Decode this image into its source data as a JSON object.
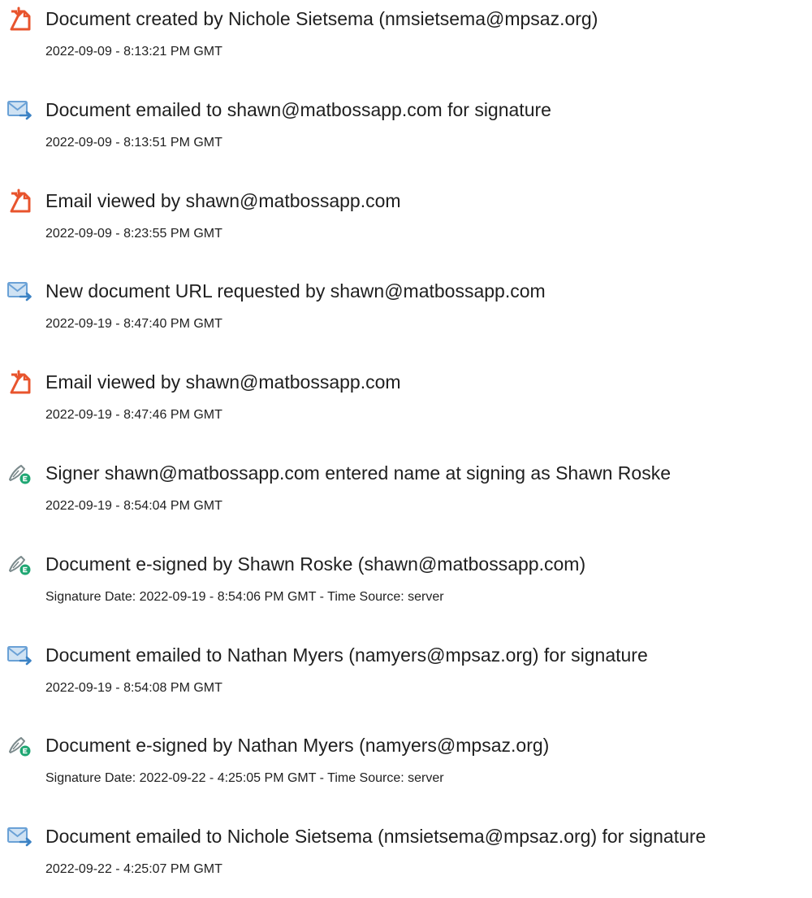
{
  "colors": {
    "text": "#1f1f1f",
    "doc_icon": "#e8542d",
    "mail_icon_body": "#cfe2f3",
    "mail_icon_stroke": "#6aa1d6",
    "mail_icon_arrow": "#3b82c4",
    "pen_icon": "#7b8a8c",
    "pen_badge": "#1ea672"
  },
  "entries": [
    {
      "icon": "document-icon",
      "title": "Document created by Nichole Sietsema (nmsietsema@mpsaz.org)",
      "detail": "2022-09-09 - 8:13:21 PM GMT"
    },
    {
      "icon": "email-sent-icon",
      "title": "Document emailed to shawn@matbossapp.com for signature",
      "detail": "2022-09-09 - 8:13:51 PM GMT"
    },
    {
      "icon": "document-icon",
      "title": "Email viewed by shawn@matbossapp.com",
      "detail": "2022-09-09 - 8:23:55 PM GMT"
    },
    {
      "icon": "email-sent-icon",
      "title": "New document URL requested by shawn@matbossapp.com",
      "detail": "2022-09-19 - 8:47:40 PM GMT"
    },
    {
      "icon": "document-icon",
      "title": "Email viewed by shawn@matbossapp.com",
      "detail": "2022-09-19 - 8:47:46 PM GMT"
    },
    {
      "icon": "esign-pen-icon",
      "title": "Signer shawn@matbossapp.com entered name at signing as Shawn Roske",
      "detail": "2022-09-19 - 8:54:04 PM GMT"
    },
    {
      "icon": "esign-pen-icon",
      "title": "Document e-signed by Shawn Roske (shawn@matbossapp.com)",
      "detail": "Signature Date: 2022-09-19 - 8:54:06 PM GMT - Time Source: server"
    },
    {
      "icon": "email-sent-icon",
      "title": "Document emailed to Nathan Myers (namyers@mpsaz.org) for signature",
      "detail": "2022-09-19 - 8:54:08 PM GMT"
    },
    {
      "icon": "esign-pen-icon",
      "title": "Document e-signed by Nathan Myers (namyers@mpsaz.org)",
      "detail": "Signature Date: 2022-09-22 - 4:25:05 PM GMT - Time Source: server"
    },
    {
      "icon": "email-sent-icon",
      "title": "Document emailed to Nichole Sietsema (nmsietsema@mpsaz.org) for signature",
      "detail": "2022-09-22 - 4:25:07 PM GMT"
    }
  ]
}
